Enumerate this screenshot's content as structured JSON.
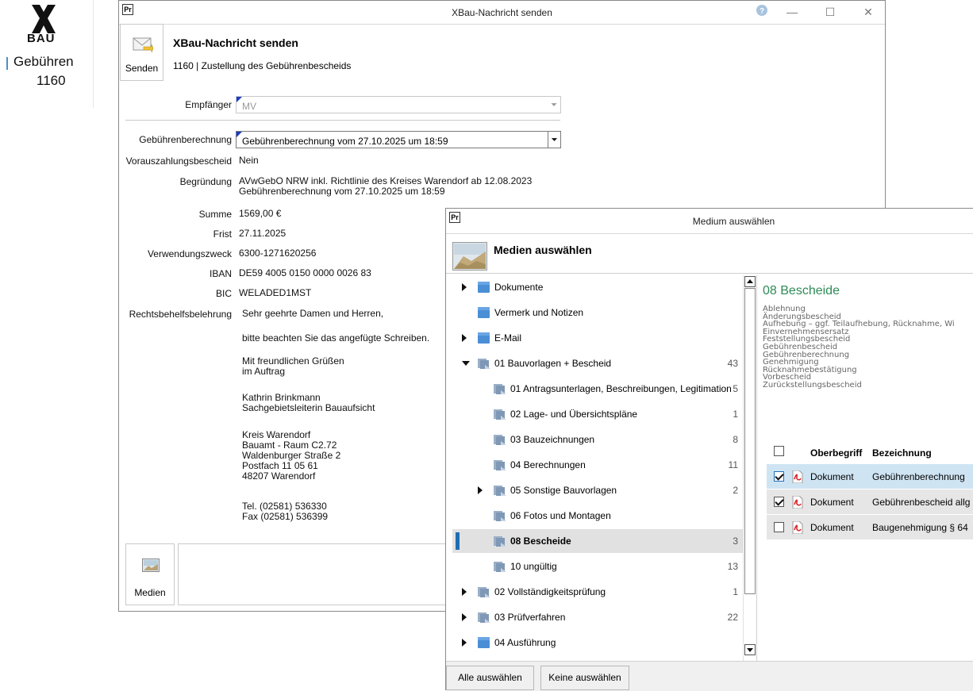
{
  "tile": {
    "logo_text": "BAU",
    "title": "Gebühren",
    "number": "1160"
  },
  "win1": {
    "title": "XBau-Nachricht senden",
    "send_button": "Senden",
    "heading": "XBau-Nachricht senden",
    "subheading": "1160 | Zustellung des Gebührenbescheids",
    "empfaenger_label": "Empfänger",
    "empfaenger_value": "MV",
    "fields": [
      {
        "label": "Gebührenberechnung",
        "value": "Gebührenberechnung vom 27.10.2025 um 18:59"
      },
      {
        "label": "Vorauszahlungsbescheid",
        "value": "Nein"
      },
      {
        "label": "Begründung",
        "value": "AVwGebO NRW inkl. Richtlinie des Kreises Warendorf ab 12.08.2023\nGebührenberechnung vom 27.10.2025 um 18:59"
      },
      {
        "label": "Summe",
        "value": "1569,00 €"
      },
      {
        "label": "Frist",
        "value": "27.11.2025"
      },
      {
        "label": "Verwendungszweck",
        "value": "6300-1271620256"
      },
      {
        "label": "IBAN",
        "value": "DE59 4005 0150 0000 0026 83"
      },
      {
        "label": "BIC",
        "value": "WELADED1MST"
      },
      {
        "label": "Rechtsbehelfsbelehrung",
        "value": "Sehr geehrte Damen und Herren,"
      }
    ],
    "letter": [
      "bitte beachten Sie das angefügte Schreiben.",
      "Mit freundlichen Grüßen\nim Auftrag",
      "Kathrin Brinkmann\nSachgebietsleiterin Bauaufsicht",
      "Kreis Warendorf\nBauamt - Raum C2.72\nWaldenburger Straße 2\nPostfach 11 05 61\n48207 Warendorf",
      "Tel. (02581) 536330\nFax (02581) 536399"
    ],
    "medien_button": "Medien"
  },
  "win2": {
    "title": "Medium auswählen",
    "heading": "Medien auswählen",
    "tree": [
      {
        "label": "Dokumente",
        "count": "",
        "level": 0,
        "expander": "right"
      },
      {
        "label": "Vermerk und Notizen",
        "count": "",
        "level": 0,
        "expander": "none"
      },
      {
        "label": "E-Mail",
        "count": "",
        "level": 0,
        "expander": "right"
      },
      {
        "label": "01 Bauvorlagen + Bescheid",
        "count": "43",
        "level": 0,
        "expander": "down"
      },
      {
        "label": "01 Antragsunterlagen, Beschreibungen, Legitimation",
        "count": "5",
        "level": 1,
        "expander": "none"
      },
      {
        "label": "02 Lage- und Übersichtspläne",
        "count": "1",
        "level": 1,
        "expander": "none"
      },
      {
        "label": "03 Bauzeichnungen",
        "count": "8",
        "level": 1,
        "expander": "none"
      },
      {
        "label": "04 Berechnungen",
        "count": "11",
        "level": 1,
        "expander": "none"
      },
      {
        "label": "05 Sonstige Bauvorlagen",
        "count": "2",
        "level": 1,
        "expander": "right"
      },
      {
        "label": "06 Fotos und Montagen",
        "count": "",
        "level": 1,
        "expander": "none"
      },
      {
        "label": "08 Bescheide",
        "count": "3",
        "level": 1,
        "expander": "none",
        "selected": true
      },
      {
        "label": "10 ungültig",
        "count": "13",
        "level": 1,
        "expander": "none"
      },
      {
        "label": "02 Vollständigkeitsprüfung",
        "count": "1",
        "level": 0,
        "expander": "right"
      },
      {
        "label": "03 Prüfverfahren",
        "count": "22",
        "level": 0,
        "expander": "right"
      },
      {
        "label": "04 Ausführung",
        "count": "",
        "level": 0,
        "expander": "right"
      }
    ],
    "detail_title": "08 Bescheide",
    "detail_lines": [
      "Ablehnung",
      "Änderungsbescheid",
      "Aufhebung – ggf. Teilaufhebung, Rücknahme, Wi",
      "Einvernehmensersatz",
      "Feststellungsbescheid",
      "Gebührenbescheid",
      "Gebührenberechnung",
      "Genehmigung",
      "Rücknahmebestätigung",
      "Vorbescheid",
      "Zurückstellungsbescheid"
    ],
    "table_headers": {
      "oberbegriff": "Oberbegriff",
      "bezeichnung": "Bezeichnung"
    },
    "table_rows": [
      {
        "checked": true,
        "oberbegriff": "Dokument",
        "bezeichnung": "Gebührenberechnung",
        "highlight": true
      },
      {
        "checked": true,
        "oberbegriff": "Dokument",
        "bezeichnung": "Gebührenbescheid allg",
        "highlight": false
      },
      {
        "checked": false,
        "oberbegriff": "Dokument",
        "bezeichnung": "Baugenehmigung § 64",
        "highlight": false
      }
    ],
    "btn_all": "Alle auswählen",
    "btn_none": "Keine auswählen"
  },
  "colors": {
    "accent_green": "#2e8b57",
    "select_blue": "#cfe4f3",
    "folder_blue": "#4a8fd6"
  }
}
